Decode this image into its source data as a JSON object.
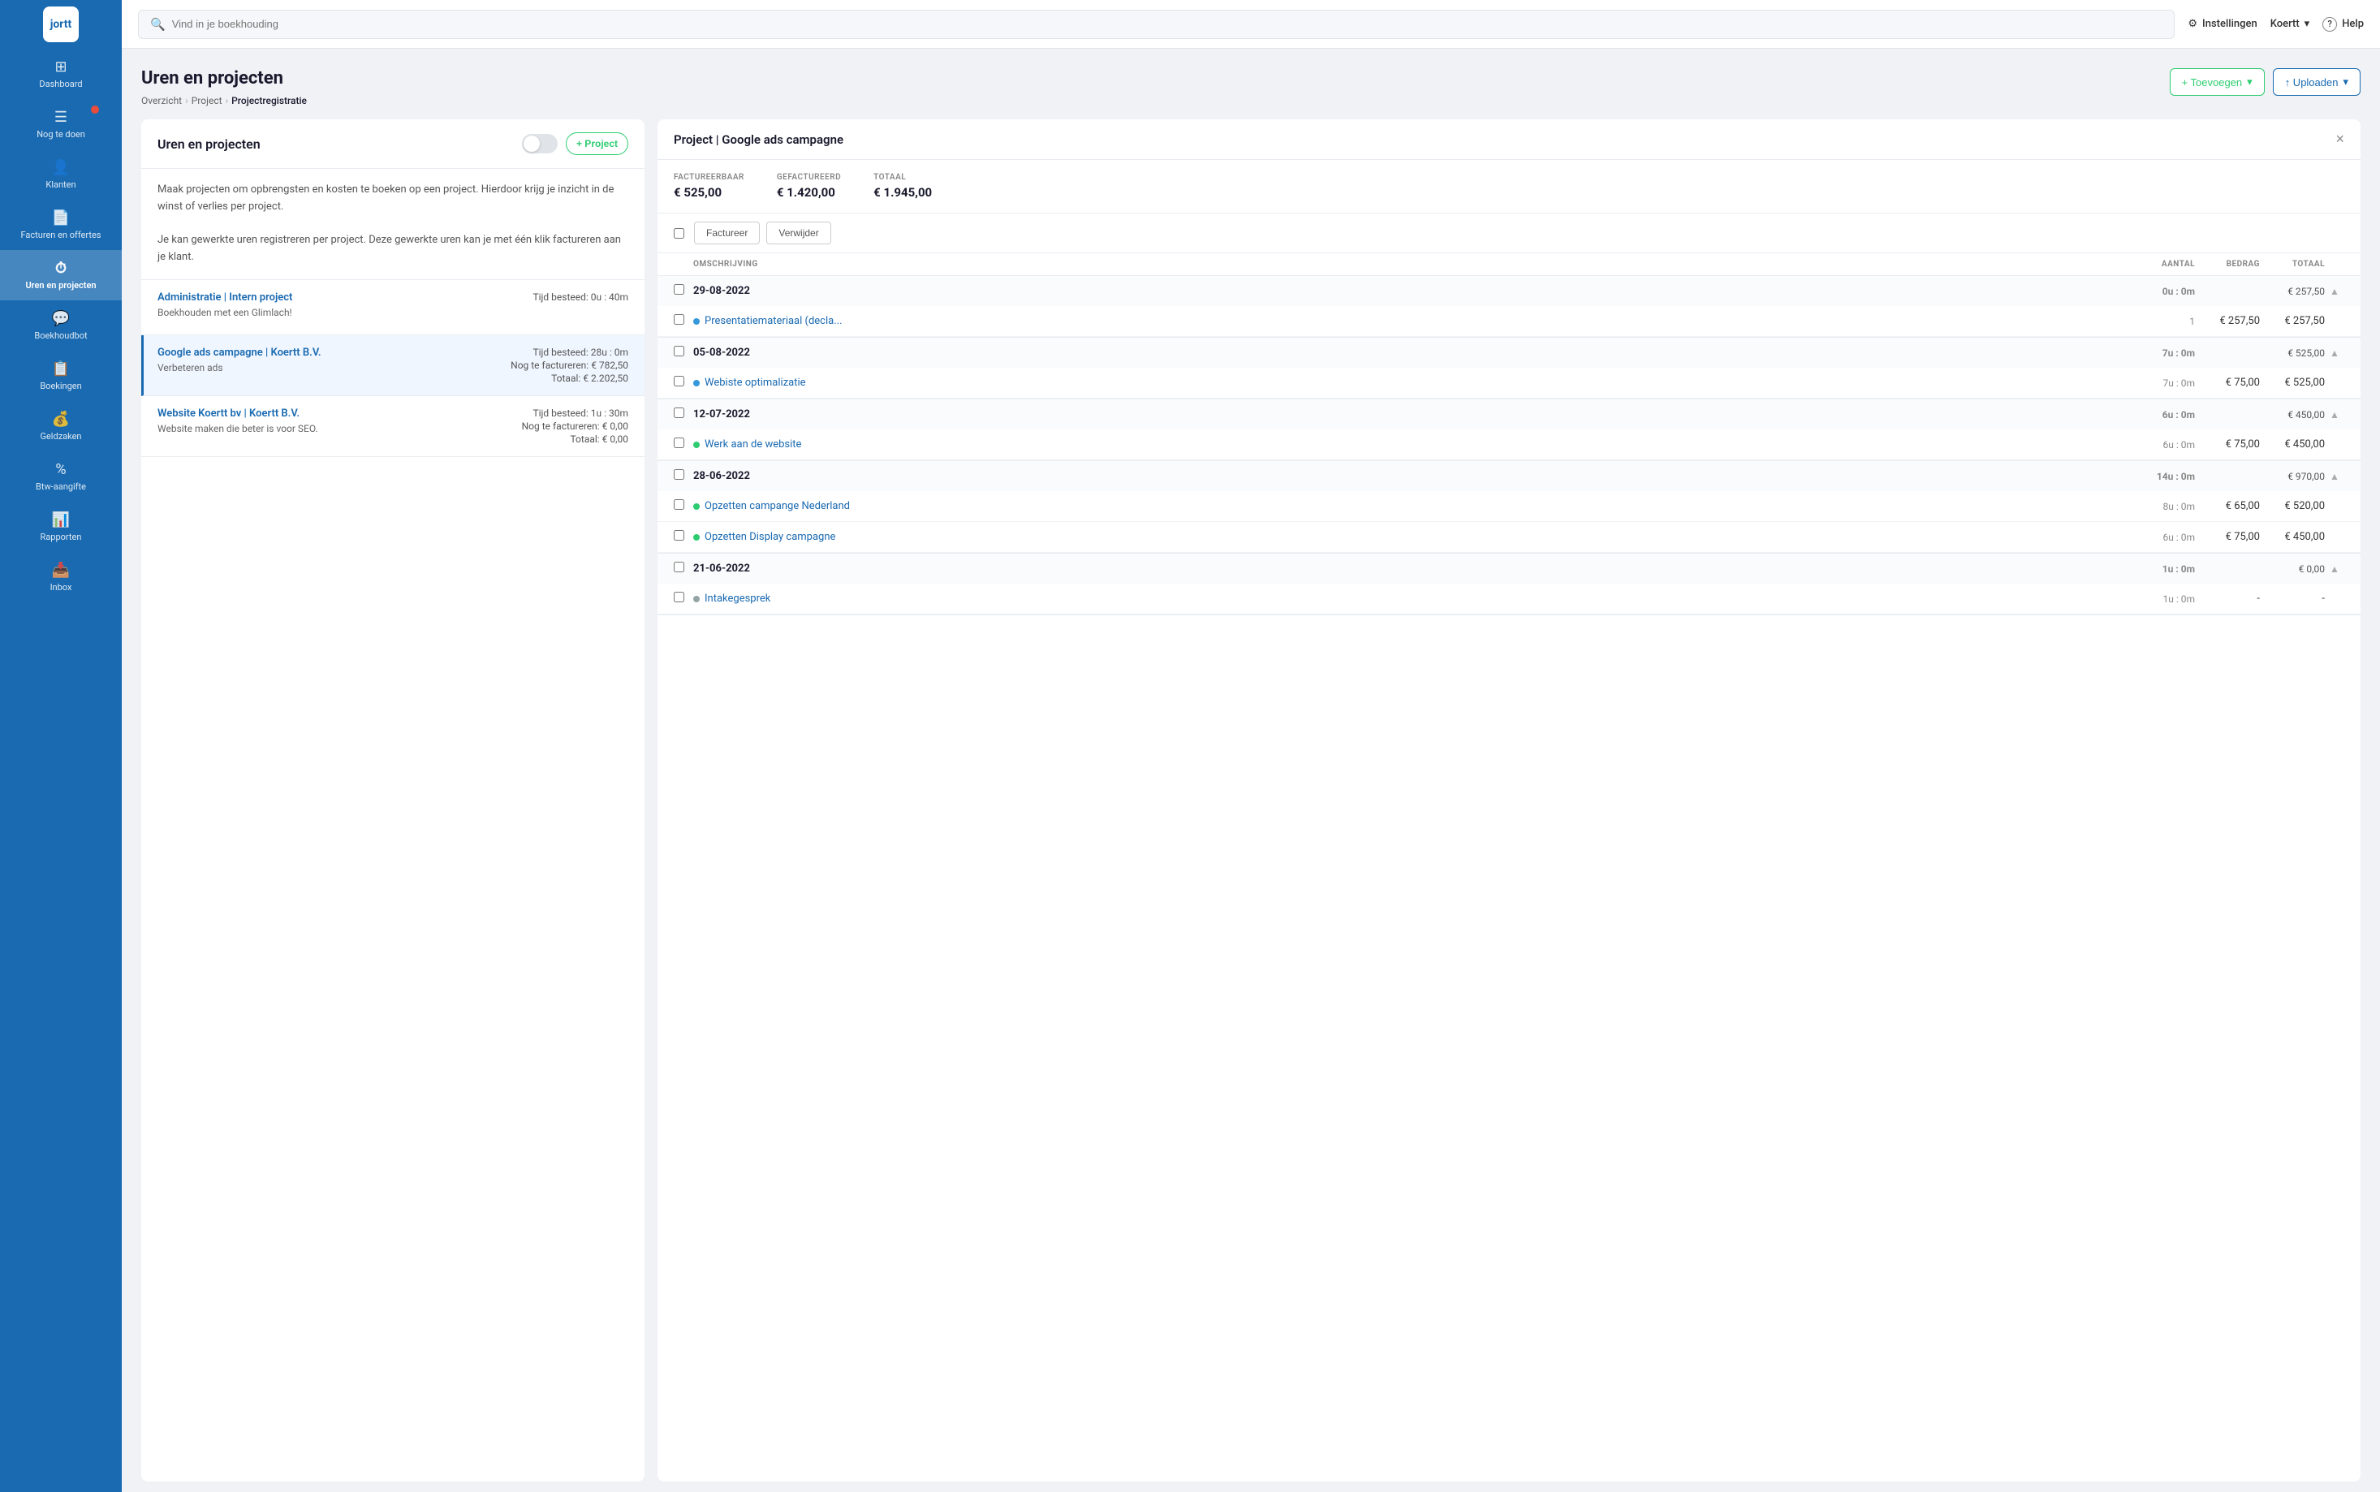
{
  "app": {
    "logo": "jortt",
    "search_placeholder": "Vind in je boekhouding"
  },
  "topbar": {
    "settings_label": "Instellingen",
    "user_label": "Koertt",
    "help_label": "Help"
  },
  "sidebar": {
    "items": [
      {
        "id": "dashboard",
        "label": "Dashboard",
        "icon": "⊞"
      },
      {
        "id": "nog-te-doen",
        "label": "Nog te doen",
        "icon": "≡",
        "badge": true
      },
      {
        "id": "klanten",
        "label": "Klanten",
        "icon": "👤"
      },
      {
        "id": "facturen-en-offertes",
        "label": "Facturen en offertes",
        "icon": "📄"
      },
      {
        "id": "uren-en-projecten",
        "label": "Uren en projecten",
        "icon": "⏱",
        "active": true
      },
      {
        "id": "boekhoudbot",
        "label": "Boekhoudbot",
        "icon": "💬"
      },
      {
        "id": "boekingen",
        "label": "Boekingen",
        "icon": "📋"
      },
      {
        "id": "geldzaken",
        "label": "Geldzaken",
        "icon": "💰"
      },
      {
        "id": "btw-aangifte",
        "label": "Btw-aangifte",
        "icon": "%"
      },
      {
        "id": "rapporten",
        "label": "Rapporten",
        "icon": "📊"
      },
      {
        "id": "inbox",
        "label": "Inbox",
        "icon": "📥"
      }
    ]
  },
  "page": {
    "title": "Uren en projecten",
    "breadcrumb": [
      "Overzicht",
      "Project",
      "Projectregistratie"
    ]
  },
  "header_actions": {
    "add_label": "+ Toevoegen",
    "upload_label": "↑ Uploaden"
  },
  "left_panel": {
    "title": "Uren en projecten",
    "new_project_label": "+ Project",
    "description_line1": "Maak projecten om opbrengsten en kosten te boeken op een project. Hierdoor krijg je inzicht in de winst of verlies per project.",
    "description_line2": "Je kan gewerkte uren registreren per project. Deze gewerkte uren kan je met één klik factureren aan je klant.",
    "projects": [
      {
        "id": "admin",
        "name": "Administratie | Intern project",
        "description": "Boekhouden met een Glimlach!",
        "tijd": "Tijd besteed: 0u : 40m",
        "active": false
      },
      {
        "id": "google-ads",
        "name": "Google ads campagne | Koertt B.V.",
        "description": "Verbeteren ads",
        "tijd": "Tijd besteed: 28u : 0m",
        "nog_te_factureren": "Nog te factureren: € 782,50",
        "totaal": "Totaal: € 2.202,50",
        "active": true
      },
      {
        "id": "website",
        "name": "Website Koertt bv | Koertt B.V.",
        "description": "Website maken die beter is voor SEO.",
        "tijd": "Tijd besteed: 1u : 30m",
        "nog_te_factureren": "Nog te factureren: € 0,00",
        "totaal": "Totaal: € 0,00",
        "active": false
      }
    ]
  },
  "right_panel": {
    "title": "Project | Google ads campagne",
    "summary": {
      "factureerbaar_label": "FACTUREERBAAR",
      "factureerbaar_value": "€ 525,00",
      "gefactureerd_label": "GEFACTUREERD",
      "gefactureerd_value": "€ 1.420,00",
      "totaal_label": "TOTAAL",
      "totaal_value": "€ 1.945,00"
    },
    "btn_factureer": "Factureer",
    "btn_verwijder": "Verwijder",
    "table_headers": {
      "omschrijving": "OMSCHRIJVING",
      "aantal": "AANTAL",
      "bedrag": "BEDRAG",
      "totaal": "TOTAAL"
    },
    "date_groups": [
      {
        "date": "29-08-2022",
        "hours": "0u : 0m",
        "totaal": "€ 257,50",
        "entries": [
          {
            "name": "Presentatiemateriaal (decla...",
            "dot": "blue",
            "aantal": "1",
            "bedrag": "€ 257,50",
            "totaal": "€ 257,50"
          }
        ]
      },
      {
        "date": "05-08-2022",
        "hours": "7u : 0m",
        "totaal": "€ 525,00",
        "entries": [
          {
            "name": "Webiste optimalizatie",
            "dot": "blue",
            "aantal": "7u : 0m",
            "bedrag": "€ 75,00",
            "totaal": "€ 525,00"
          }
        ]
      },
      {
        "date": "12-07-2022",
        "hours": "6u : 0m",
        "totaal": "€ 450,00",
        "entries": [
          {
            "name": "Werk aan de website",
            "dot": "green",
            "aantal": "6u : 0m",
            "bedrag": "€ 75,00",
            "totaal": "€ 450,00"
          }
        ]
      },
      {
        "date": "28-06-2022",
        "hours": "14u : 0m",
        "totaal": "€ 970,00",
        "entries": [
          {
            "name": "Opzetten campange Nederland",
            "dot": "green",
            "aantal": "8u : 0m",
            "bedrag": "€ 65,00",
            "totaal": "€ 520,00"
          },
          {
            "name": "Opzetten Display campagne",
            "dot": "green",
            "aantal": "6u : 0m",
            "bedrag": "€ 75,00",
            "totaal": "€ 450,00"
          }
        ]
      },
      {
        "date": "21-06-2022",
        "hours": "1u : 0m",
        "totaal": "€ 0,00",
        "entries": [
          {
            "name": "Intakegesprek",
            "dot": "gray",
            "aantal": "1u : 0m",
            "bedrag": "-",
            "totaal": "-"
          }
        ]
      }
    ]
  }
}
